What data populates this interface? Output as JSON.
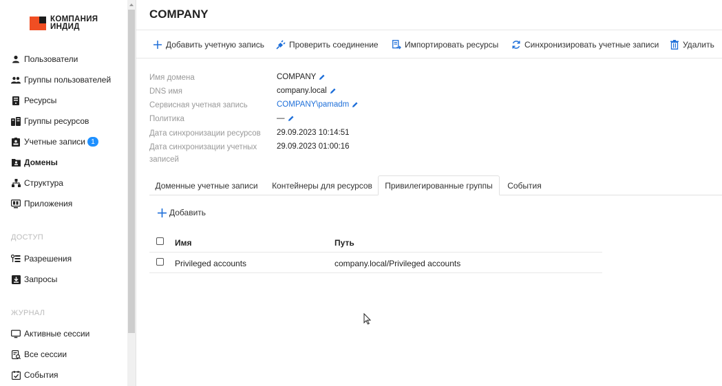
{
  "brand": {
    "line1": "КОМПАНИЯ",
    "line2": "ИНДИД"
  },
  "sidebar": {
    "items": [
      {
        "label": "Пользователи",
        "icon": "user-icon"
      },
      {
        "label": "Группы пользователей",
        "icon": "users-icon"
      },
      {
        "label": "Ресурсы",
        "icon": "server-icon"
      },
      {
        "label": "Группы ресурсов",
        "icon": "server-group-icon"
      },
      {
        "label": "Учетные записи",
        "icon": "id-card-icon",
        "badge": "1"
      },
      {
        "label": "Домены",
        "icon": "domain-icon",
        "active": true
      },
      {
        "label": "Структура",
        "icon": "tree-icon"
      },
      {
        "label": "Приложения",
        "icon": "app-icon"
      }
    ],
    "access_section": "ДОСТУП",
    "access_items": [
      {
        "label": "Разрешения",
        "icon": "permissions-icon"
      },
      {
        "label": "Запросы",
        "icon": "requests-icon"
      }
    ],
    "journal_section": "ЖУРНАЛ",
    "journal_items": [
      {
        "label": "Активные сессии",
        "icon": "monitor-icon"
      },
      {
        "label": "Все сессии",
        "icon": "sessions-icon"
      },
      {
        "label": "События",
        "icon": "events-icon"
      }
    ]
  },
  "page": {
    "title": "COMPANY"
  },
  "toolbar": {
    "add_account": "Добавить учетную запись",
    "check_connection": "Проверить соединение",
    "import_resources": "Импортировать ресурсы",
    "sync_accounts": "Синхронизировать учетные записи",
    "delete": "Удалить"
  },
  "details": {
    "domain_name_label": "Имя домена",
    "domain_name_value": "COMPANY",
    "dns_label": "DNS имя",
    "dns_value": "company.local",
    "service_account_label": "Сервисная учетная запись",
    "service_account_value": "COMPANY\\pamadm",
    "policy_label": "Политика",
    "policy_value": "—",
    "resource_sync_label": "Дата синхронизации ресурсов",
    "resource_sync_value": "29.09.2023 10:14:51",
    "account_sync_label_line1": "Дата синхронизации учетных",
    "account_sync_label_line2": "записей",
    "account_sync_value": "29.09.2023 01:00:16"
  },
  "tabs": [
    {
      "label": "Доменные учетные записи"
    },
    {
      "label": "Контейнеры для ресурсов"
    },
    {
      "label": "Привилегированные группы",
      "active": true
    },
    {
      "label": "События"
    }
  ],
  "table": {
    "add_label": "Добавить",
    "columns": [
      "Имя",
      "Путь"
    ],
    "rows": [
      {
        "name": "Privileged accounts",
        "path": "company.local/Privileged accounts"
      }
    ]
  },
  "colors": {
    "accent": "#1e6fd9",
    "brand": "#f04e23",
    "badge": "#1e90ff"
  }
}
